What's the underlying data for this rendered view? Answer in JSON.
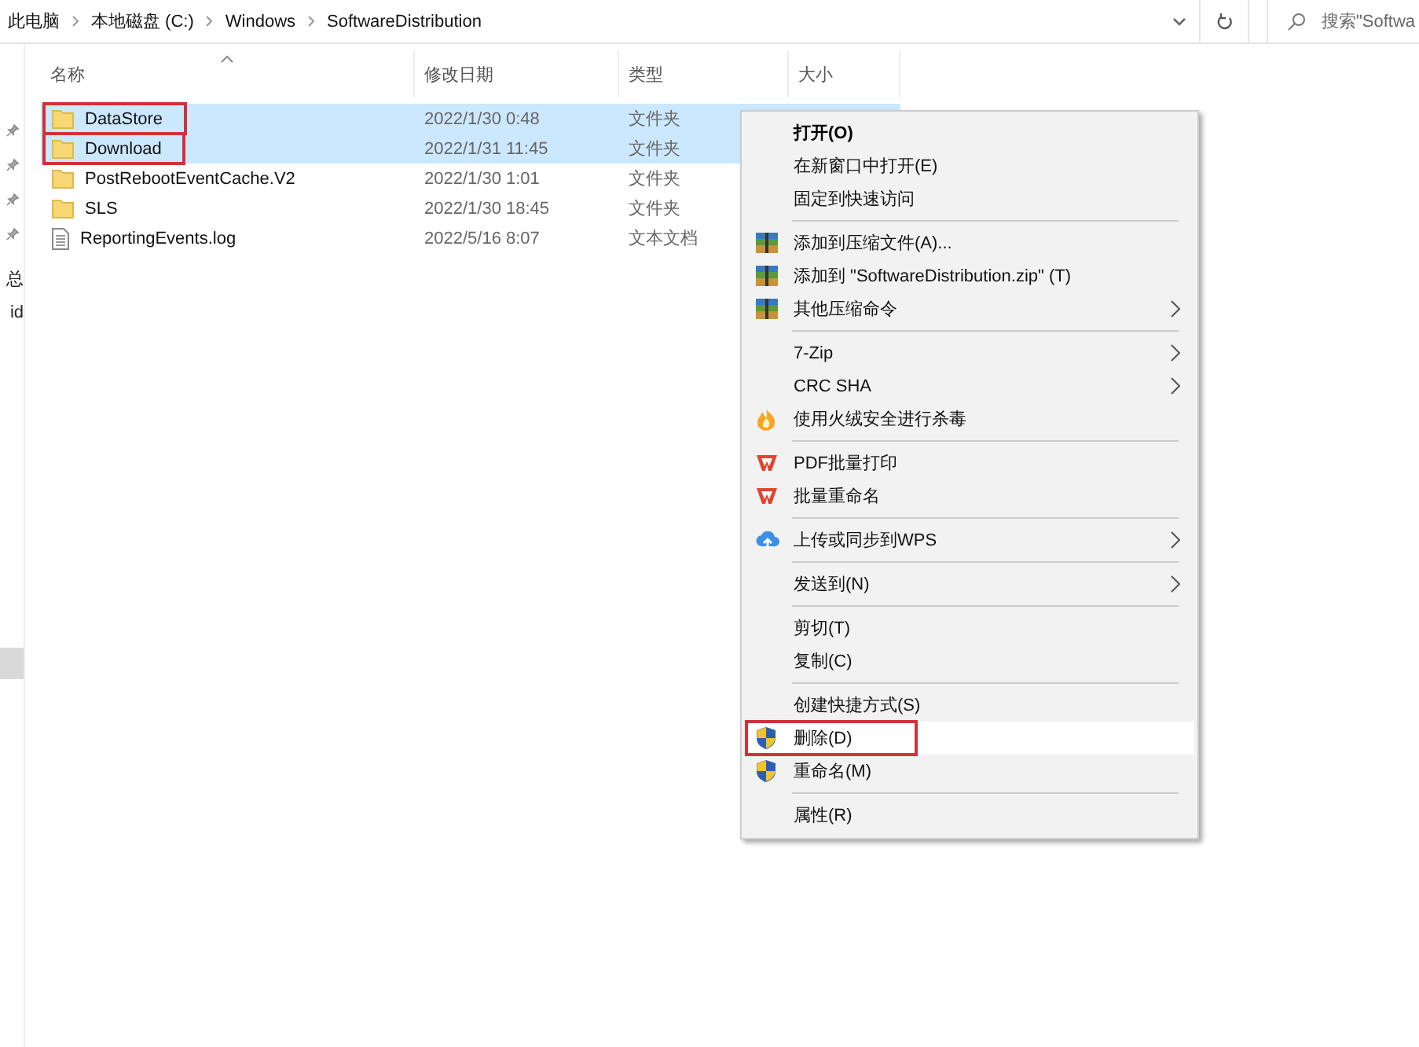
{
  "address_bar": {
    "path": [
      "此电脑",
      "本地磁盘 (C:)",
      "Windows",
      "SoftwareDistribution"
    ],
    "search": {
      "placeholder": "搜索\"Softwa"
    }
  },
  "nav_pane": {
    "items": [
      {
        "kind": "pinned",
        "selected": false
      },
      {
        "kind": "pinned",
        "selected": false
      },
      {
        "kind": "pinned",
        "selected": false
      },
      {
        "kind": "pinned",
        "selected": false
      },
      {
        "kind": "text",
        "label": "总",
        "selected": false
      },
      {
        "kind": "text",
        "label": "id",
        "selected": false
      },
      {
        "kind": "blank",
        "selected": true
      }
    ]
  },
  "file_list": {
    "columns": [
      {
        "label": "名称",
        "sorted": true
      },
      {
        "label": "修改日期",
        "sorted": false
      },
      {
        "label": "类型",
        "sorted": false
      },
      {
        "label": "大小",
        "sorted": false
      }
    ],
    "rows": [
      {
        "kind": "folder",
        "name": "DataStore",
        "modified": "2022/1/30 0:48",
        "type": "文件夹",
        "selected": true,
        "outlined": true
      },
      {
        "kind": "folder",
        "name": "Download",
        "modified": "2022/1/31 11:45",
        "type": "文件夹",
        "selected": true,
        "outlined": true
      },
      {
        "kind": "folder",
        "name": "PostRebootEventCache.V2",
        "modified": "2022/1/30 1:01",
        "type": "文件夹",
        "selected": false,
        "outlined": false
      },
      {
        "kind": "folder",
        "name": "SLS",
        "modified": "2022/1/30 18:45",
        "type": "文件夹",
        "selected": false,
        "outlined": false
      },
      {
        "kind": "file",
        "name": "ReportingEvents.log",
        "modified": "2022/5/16 8:07",
        "type": "文本文档",
        "selected": false,
        "outlined": false
      }
    ]
  },
  "context_menu": {
    "items": [
      {
        "kind": "command",
        "label": "打开(O)",
        "bold": true,
        "submenu": false,
        "selected": false,
        "outlined": false
      },
      {
        "kind": "command",
        "label": "在新窗口中打开(E)",
        "bold": false,
        "submenu": false,
        "selected": false,
        "outlined": false
      },
      {
        "kind": "command",
        "label": "固定到快速访问",
        "bold": false,
        "submenu": false,
        "selected": false,
        "outlined": false
      },
      {
        "kind": "separator"
      },
      {
        "kind": "archive",
        "label": "添加到压缩文件(A)...",
        "bold": false,
        "submenu": false,
        "selected": false,
        "outlined": false
      },
      {
        "kind": "archive",
        "label": "添加到 \"SoftwareDistribution.zip\" (T)",
        "bold": false,
        "submenu": false,
        "selected": false,
        "outlined": false
      },
      {
        "kind": "archive",
        "label": "其他压缩命令",
        "bold": false,
        "submenu": true,
        "selected": false,
        "outlined": false
      },
      {
        "kind": "separator"
      },
      {
        "kind": "command",
        "label": "7-Zip",
        "bold": false,
        "submenu": true,
        "selected": false,
        "outlined": false
      },
      {
        "kind": "command",
        "label": "CRC SHA",
        "bold": false,
        "submenu": true,
        "selected": false,
        "outlined": false
      },
      {
        "kind": "antivirus",
        "label": "使用火绒安全进行杀毒",
        "bold": false,
        "submenu": false,
        "selected": false,
        "outlined": false
      },
      {
        "kind": "separator"
      },
      {
        "kind": "wps",
        "label": "PDF批量打印",
        "bold": false,
        "submenu": false,
        "selected": false,
        "outlined": false
      },
      {
        "kind": "wps",
        "label": "批量重命名",
        "bold": false,
        "submenu": false,
        "selected": false,
        "outlined": false
      },
      {
        "kind": "separator"
      },
      {
        "kind": "cloud",
        "label": "上传或同步到WPS",
        "bold": false,
        "submenu": true,
        "selected": false,
        "outlined": false
      },
      {
        "kind": "separator"
      },
      {
        "kind": "command",
        "label": "发送到(N)",
        "bold": false,
        "submenu": true,
        "selected": false,
        "outlined": false
      },
      {
        "kind": "separator"
      },
      {
        "kind": "command",
        "label": "剪切(T)",
        "bold": false,
        "submenu": false,
        "selected": false,
        "outlined": false
      },
      {
        "kind": "command",
        "label": "复制(C)",
        "bold": false,
        "submenu": false,
        "selected": false,
        "outlined": false
      },
      {
        "kind": "separator"
      },
      {
        "kind": "command",
        "label": "创建快捷方式(S)",
        "bold": false,
        "submenu": false,
        "selected": false,
        "outlined": false
      },
      {
        "kind": "admin",
        "label": "删除(D)",
        "bold": false,
        "submenu": false,
        "selected": true,
        "outlined": true
      },
      {
        "kind": "admin",
        "label": "重命名(M)",
        "bold": false,
        "submenu": false,
        "selected": false,
        "outlined": false
      },
      {
        "kind": "separator"
      },
      {
        "kind": "command",
        "label": "属性(R)",
        "bold": false,
        "submenu": false,
        "selected": false,
        "outlined": false
      }
    ]
  }
}
